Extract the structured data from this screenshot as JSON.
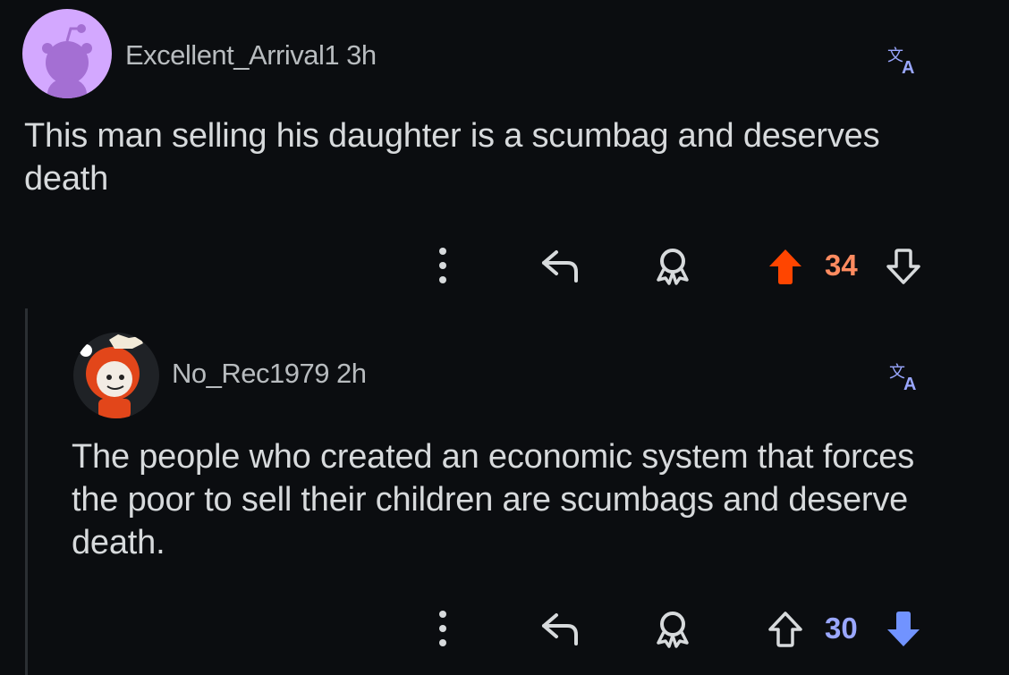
{
  "comment1": {
    "username": "Excellent_Arrival1",
    "time": "3h",
    "body": "This man selling his daughter is a scumbag and deserves death",
    "votes": "34",
    "vote_state": "upvoted",
    "vote_color": "#ff4500"
  },
  "comment2": {
    "username": "No_Rec1979",
    "time": "2h",
    "body": "The people who created an economic system that forces the poor to sell their children are scumbags and deserve death.",
    "votes": "30",
    "vote_state": "downvoted",
    "vote_color": "#7193ff"
  },
  "icons": {
    "translate": "translate-icon",
    "more": "more-vertical-icon",
    "reply": "reply-icon",
    "award": "award-icon",
    "upvote": "upvote-arrow-icon",
    "downvote": "downvote-arrow-icon"
  },
  "colors": {
    "background": "#0b0d10",
    "text": "#d7dadc",
    "muted": "#b8bcbf",
    "upvote": "#ff4500",
    "downvote": "#7193ff"
  }
}
